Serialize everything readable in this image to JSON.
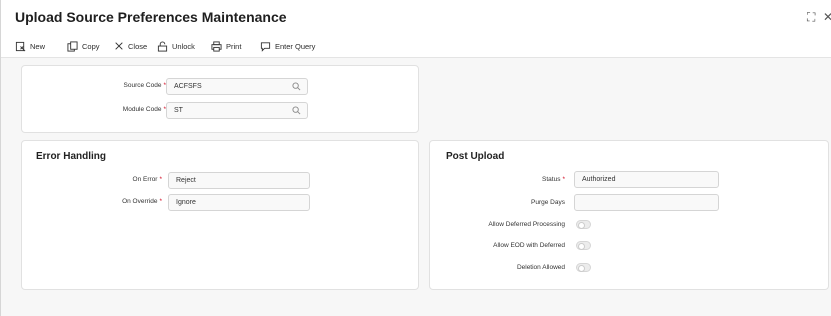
{
  "window": {
    "title": "Upload Source Preferences Maintenance",
    "maximize_glyph": "⛶",
    "close_glyph": "✕"
  },
  "toolbar": {
    "new_label": "New",
    "copy_label": "Copy",
    "close_label": "Close",
    "unlock_label": "Unlock",
    "print_label": "Print",
    "enter_query_label": "Enter Query"
  },
  "header_section": {
    "source_code": {
      "label": "Source Code",
      "value": "ACFSFS"
    },
    "module_code": {
      "label": "Module Code",
      "value": "ST"
    },
    "required_mark": "*"
  },
  "error_handling": {
    "title": "Error Handling",
    "on_error": {
      "label": "On Error",
      "value": "Reject"
    },
    "on_override": {
      "label": "On Override",
      "value": "Ignore"
    }
  },
  "post_upload": {
    "title": "Post Upload",
    "status": {
      "label": "Status",
      "value": "Authorized"
    },
    "purge_days": {
      "label": "Purge Days",
      "value": ""
    },
    "allow_deferred_processing": {
      "label": "Allow Deferred Processing",
      "enabled": false
    },
    "allow_eod_with_deferred": {
      "label": "Allow EOD with Deferred",
      "enabled": false
    },
    "deletion_allowed": {
      "label": "Deletion Allowed",
      "enabled": false
    }
  },
  "colors": {
    "required": "#d0021b",
    "panel_bg": "#ffffff",
    "page_bg": "#f7f7f7"
  }
}
